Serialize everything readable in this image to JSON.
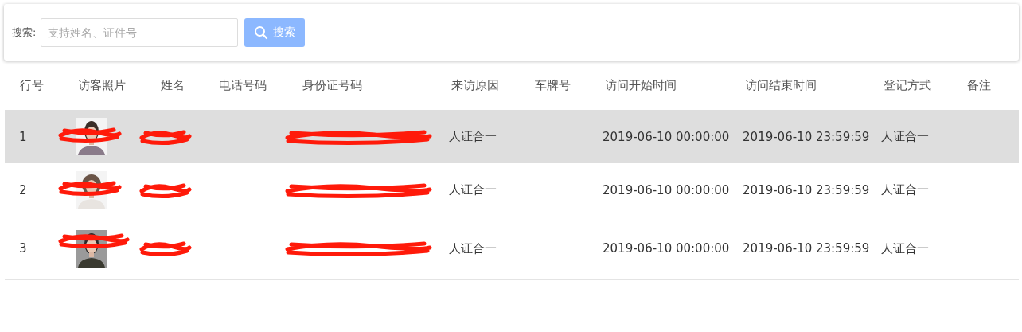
{
  "search": {
    "label": "搜索:",
    "placeholder": "支持姓名、证件号",
    "button": "搜索"
  },
  "table": {
    "columns": [
      "行号",
      "访客照片",
      "姓名",
      "电话号码",
      "身份证号码",
      "来访原因",
      "车牌号",
      "访问开始时间",
      "访问结束时间",
      "登记方式",
      "备注"
    ],
    "rows": [
      {
        "index": "1",
        "reason": "人证合一",
        "start": "2019-06-10 00:00:00",
        "end": "2019-06-10 23:59:59",
        "method": "人证合一",
        "selected": true
      },
      {
        "index": "2",
        "reason": "人证合一",
        "start": "2019-06-10 00:00:00",
        "end": "2019-06-10 23:59:59",
        "method": "人证合一",
        "selected": false
      },
      {
        "index": "3",
        "reason": "人证合一",
        "start": "2019-06-10 00:00:00",
        "end": "2019-06-10 23:59:59",
        "method": "人证合一",
        "selected": false
      }
    ]
  }
}
